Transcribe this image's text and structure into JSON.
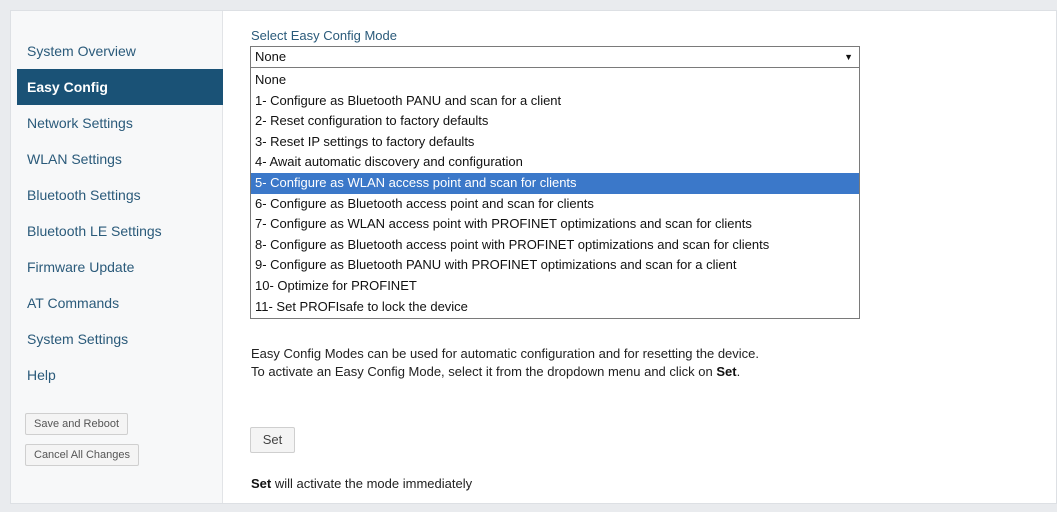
{
  "sidebar": {
    "items": [
      {
        "label": "System Overview"
      },
      {
        "label": "Easy Config"
      },
      {
        "label": "Network Settings"
      },
      {
        "label": "WLAN Settings"
      },
      {
        "label": "Bluetooth Settings"
      },
      {
        "label": "Bluetooth LE Settings"
      },
      {
        "label": "Firmware Update"
      },
      {
        "label": "AT Commands"
      },
      {
        "label": "System Settings"
      },
      {
        "label": "Help"
      }
    ],
    "active_item": "Easy Config",
    "save_reboot_label": "Save and Reboot",
    "cancel_changes_label": "Cancel All Changes"
  },
  "main": {
    "section_label": "Select Easy Config Mode",
    "select_value": "None",
    "options": [
      "None",
      "1- Configure as Bluetooth PANU and scan for a client",
      "2- Reset configuration to factory defaults",
      "3- Reset IP settings to factory defaults",
      "4- Await automatic discovery and configuration",
      "5- Configure as WLAN access point and scan for clients",
      "6- Configure as Bluetooth access point and scan for clients",
      "7- Configure as WLAN access point with PROFINET optimizations and scan for clients",
      "8- Configure as Bluetooth access point with PROFINET optimizations and scan for clients",
      "9- Configure as Bluetooth PANU with PROFINET optimizations and scan for a client",
      "10- Optimize for PROFINET",
      "11- Set PROFIsafe to lock the device"
    ],
    "highlighted_option": "5- Configure as WLAN access point and scan for clients",
    "help_line1": "Easy Config Modes can be used for automatic configuration and for resetting the device.",
    "help_line2_prefix": "To activate an Easy Config Mode, select it from the dropdown menu and click on ",
    "help_line2_bold": "Set",
    "help_line2_suffix": ".",
    "set_button_label": "Set",
    "footer_bold": "Set",
    "footer_rest": " will activate the mode immediately"
  },
  "colors": {
    "active_nav_bg": "#1a5276",
    "highlight_option_bg": "#3b78c9",
    "nav_text": "#2a5a7a"
  }
}
